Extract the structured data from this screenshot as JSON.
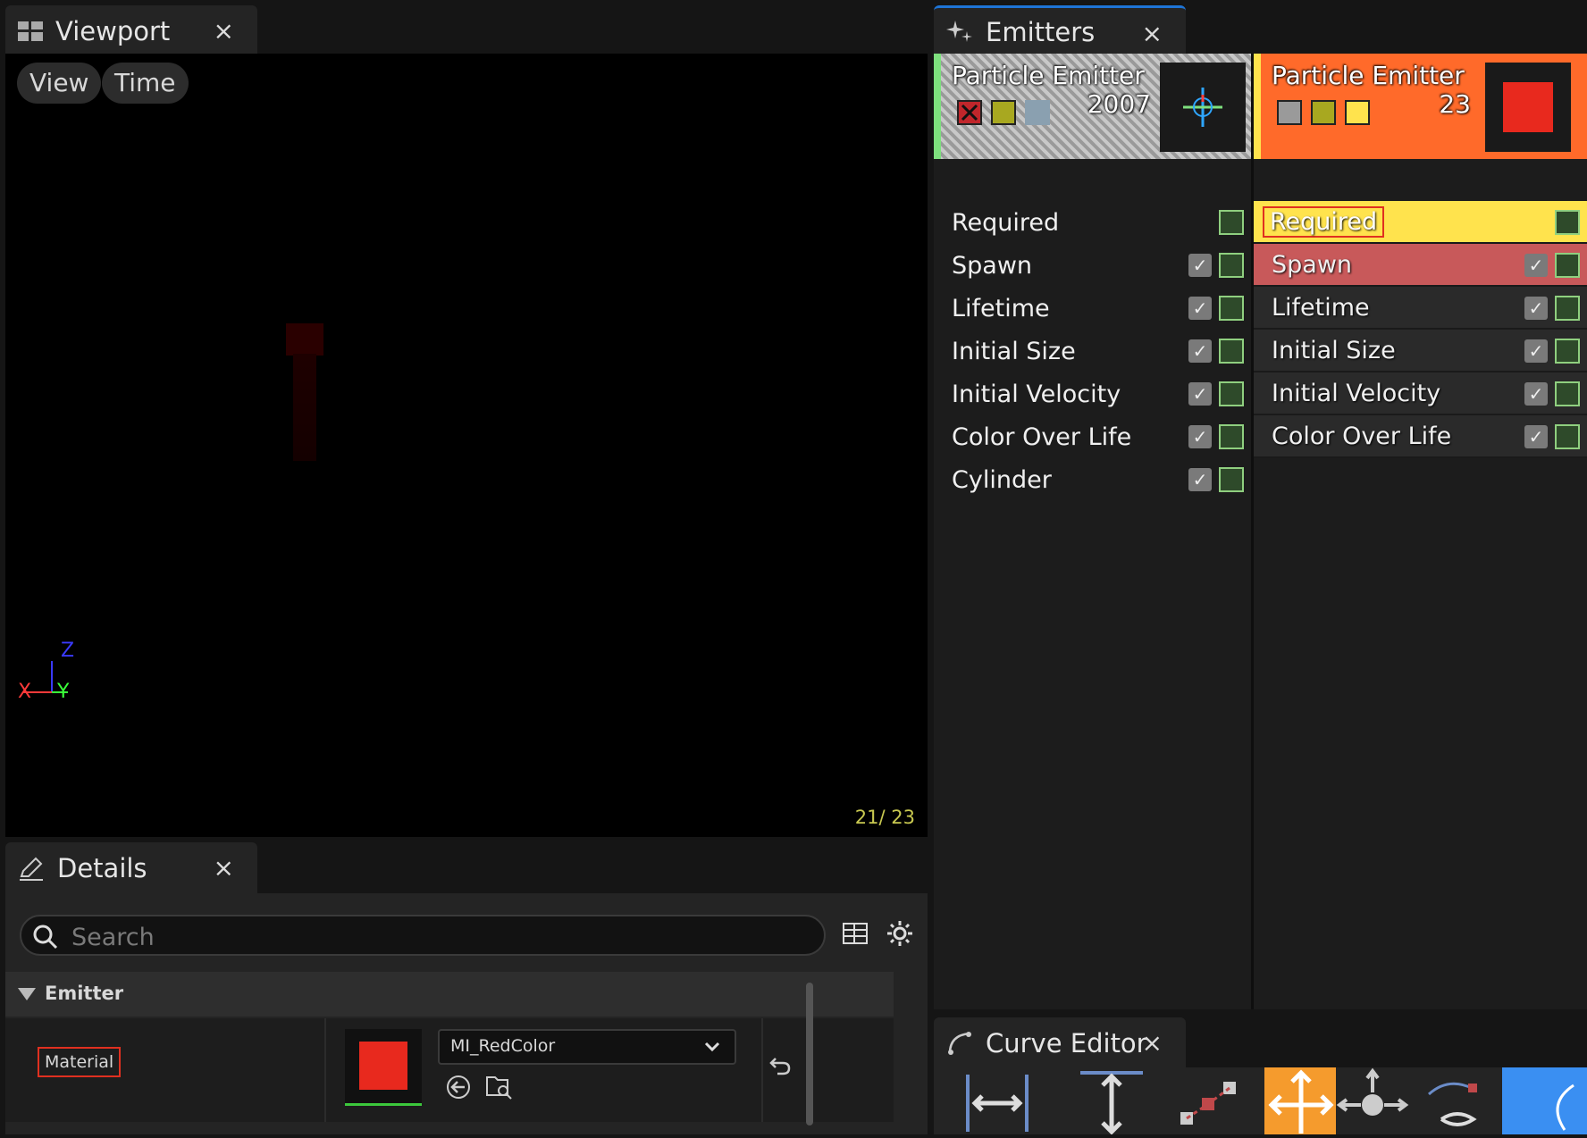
{
  "viewport_tab": {
    "title": "Viewport",
    "close": "×"
  },
  "viewport": {
    "view_label": "View",
    "time_label": "Time",
    "frame_counter": "21/ 23",
    "axis": {
      "z": "Z",
      "x": "X",
      "y": "Y"
    }
  },
  "emitters_tab": {
    "title": "Emitters",
    "close": "×"
  },
  "emitters": [
    {
      "name": "Particle Emitter",
      "count": "2007",
      "accent_color": "#7ee07e",
      "modules": [
        "Required",
        "Spawn",
        "Lifetime",
        "Initial Size",
        "Initial Velocity",
        "Color Over Life",
        "Cylinder"
      ]
    },
    {
      "name": "Particle Emitter",
      "count": "23",
      "accent_color": "#ffe34d",
      "header_color": "#ff6a2a",
      "modules": [
        "Required",
        "Spawn",
        "Lifetime",
        "Initial Size",
        "Initial Velocity",
        "Color Over Life"
      ],
      "selected_module": "Required",
      "highlighted_module": "Spawn"
    }
  ],
  "details_tab": {
    "title": "Details",
    "close": "×"
  },
  "details": {
    "search_placeholder": "Search",
    "category": "Emitter",
    "material_label": "Material",
    "material_value": "MI_RedColor"
  },
  "curve_editor_tab": {
    "title": "Curve Editor",
    "close": "×"
  },
  "colors": {
    "selection_yellow": "#ffe34d",
    "spawn_red": "#c8595a",
    "material_red": "#e8291e"
  }
}
